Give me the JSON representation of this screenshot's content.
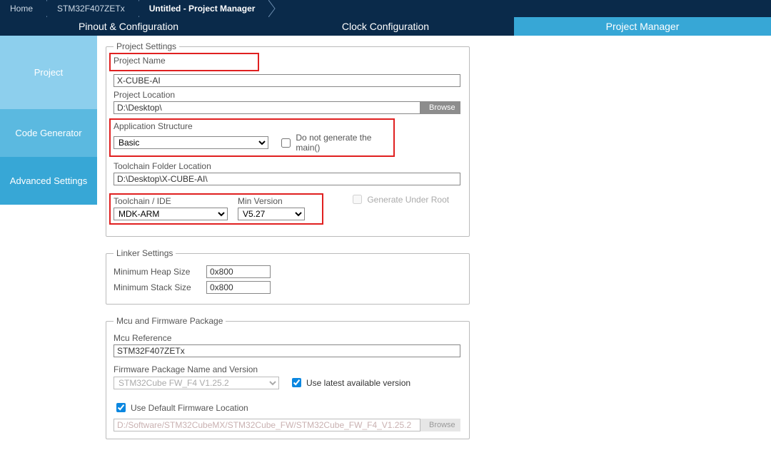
{
  "breadcrumb": {
    "home": "Home",
    "device": "STM32F407ZETx",
    "current": "Untitled - Project Manager"
  },
  "tabs": {
    "pinout": "Pinout & Configuration",
    "clock": "Clock Configuration",
    "projmgr": "Project Manager"
  },
  "sidebar": {
    "project": "Project",
    "codegen": "Code Generator",
    "advanced": "Advanced Settings"
  },
  "projectSettings": {
    "legend": "Project Settings",
    "projectNameLabel": "Project Name",
    "projectName": "X-CUBE-AI",
    "projectLocationLabel": "Project Location",
    "projectLocation": "D:\\Desktop\\",
    "browse": "Browse",
    "appStructureLabel": "Application Structure",
    "appStructure": "Basic",
    "dontGenMain": "Do not generate the main()",
    "toolchainFolderLabel": "Toolchain Folder Location",
    "toolchainFolder": "D:\\Desktop\\X-CUBE-AI\\",
    "toolchainIdeLabel": "Toolchain / IDE",
    "toolchainIde": "MDK-ARM",
    "minVersionLabel": "Min Version",
    "minVersion": "V5.27",
    "genUnderRoot": "Generate Under Root"
  },
  "linker": {
    "legend": "Linker Settings",
    "heapLabel": "Minimum Heap Size",
    "heap": "0x800",
    "stackLabel": "Minimum Stack Size",
    "stack": "0x800"
  },
  "mcu": {
    "legend": "Mcu and Firmware Package",
    "mcuRefLabel": "Mcu Reference",
    "mcuRef": "STM32F407ZETx",
    "fwLabel": "Firmware Package Name and Version",
    "fwValue": "STM32Cube FW_F4 V1.25.2",
    "useLatest": "Use latest available version",
    "useDefaultLoc": "Use Default Firmware Location",
    "fwPath": "D:/Software/STM32CubeMX/STM32Cube_FW/STM32Cube_FW_F4_V1.25.2",
    "browse": "Browse"
  }
}
